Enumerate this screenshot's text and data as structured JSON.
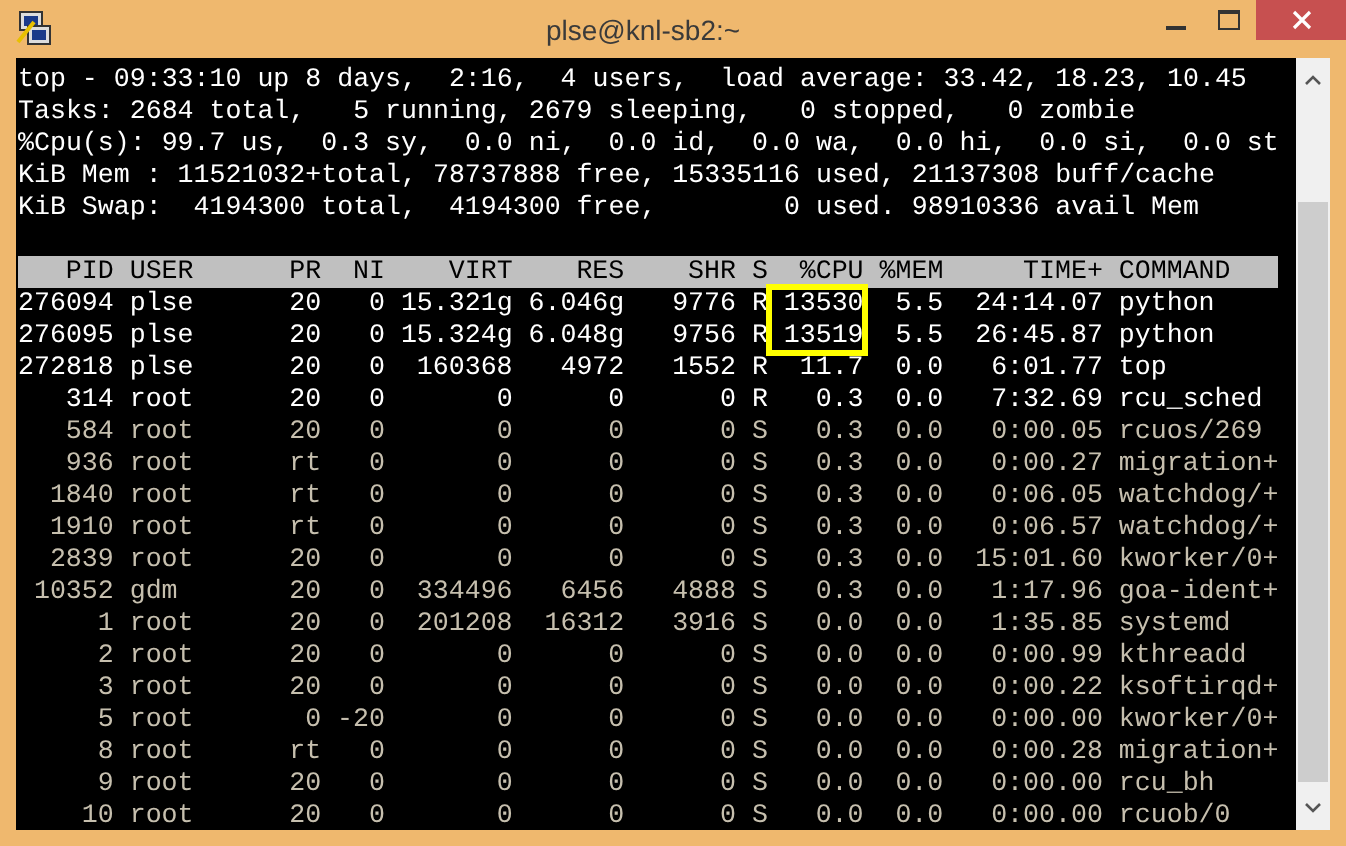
{
  "window": {
    "title": "plse@knl-sb2:~"
  },
  "summary": [
    "top - 09:33:10 up 8 days,  2:16,  4 users,  load average: 33.42, 18.23, 10.45",
    "Tasks: 2684 total,   5 running, 2679 sleeping,   0 stopped,   0 zombie",
    "%Cpu(s): 99.7 us,  0.3 sy,  0.0 ni,  0.0 id,  0.0 wa,  0.0 hi,  0.0 si,  0.0 st",
    "KiB Mem : 11521032+total, 78737888 free, 15335116 used, 21137308 buff/cache",
    "KiB Swap:  4194300 total,  4194300 free,        0 used. 98910336 avail Mem"
  ],
  "table": {
    "columns": [
      "PID",
      "USER",
      "PR",
      "NI",
      "VIRT",
      "RES",
      "SHR",
      "S",
      "%CPU",
      "%MEM",
      "TIME+",
      "COMMAND"
    ],
    "rows": [
      {
        "cells": [
          "276094",
          "plse",
          "20",
          "0",
          "15.321g",
          "6.046g",
          "9776",
          "R",
          "13530",
          "5.5",
          "24:14.07",
          "python"
        ],
        "bright": true,
        "boxed": true
      },
      {
        "cells": [
          "276095",
          "plse",
          "20",
          "0",
          "15.324g",
          "6.048g",
          "9756",
          "R",
          "13519",
          "5.5",
          "26:45.87",
          "python"
        ],
        "bright": true,
        "boxed": true
      },
      {
        "cells": [
          "272818",
          "plse",
          "20",
          "0",
          "160368",
          "4972",
          "1552",
          "R",
          "11.7",
          "0.0",
          "6:01.77",
          "top"
        ],
        "bright": true,
        "boxed": false
      },
      {
        "cells": [
          "314",
          "root",
          "20",
          "0",
          "0",
          "0",
          "0",
          "R",
          "0.3",
          "0.0",
          "7:32.69",
          "rcu_sched"
        ],
        "bright": true,
        "boxed": false
      },
      {
        "cells": [
          "584",
          "root",
          "20",
          "0",
          "0",
          "0",
          "0",
          "S",
          "0.3",
          "0.0",
          "0:00.05",
          "rcuos/269"
        ],
        "bright": false,
        "boxed": false
      },
      {
        "cells": [
          "936",
          "root",
          "rt",
          "0",
          "0",
          "0",
          "0",
          "S",
          "0.3",
          "0.0",
          "0:00.27",
          "migration+"
        ],
        "bright": false,
        "boxed": false
      },
      {
        "cells": [
          "1840",
          "root",
          "rt",
          "0",
          "0",
          "0",
          "0",
          "S",
          "0.3",
          "0.0",
          "0:06.05",
          "watchdog/+"
        ],
        "bright": false,
        "boxed": false
      },
      {
        "cells": [
          "1910",
          "root",
          "rt",
          "0",
          "0",
          "0",
          "0",
          "S",
          "0.3",
          "0.0",
          "0:06.57",
          "watchdog/+"
        ],
        "bright": false,
        "boxed": false
      },
      {
        "cells": [
          "2839",
          "root",
          "20",
          "0",
          "0",
          "0",
          "0",
          "S",
          "0.3",
          "0.0",
          "15:01.60",
          "kworker/0+"
        ],
        "bright": false,
        "boxed": false
      },
      {
        "cells": [
          "10352",
          "gdm",
          "20",
          "0",
          "334496",
          "6456",
          "4888",
          "S",
          "0.3",
          "0.0",
          "1:17.96",
          "goa-ident+"
        ],
        "bright": false,
        "boxed": false
      },
      {
        "cells": [
          "1",
          "root",
          "20",
          "0",
          "201208",
          "16312",
          "3916",
          "S",
          "0.0",
          "0.0",
          "1:35.85",
          "systemd"
        ],
        "bright": false,
        "boxed": false
      },
      {
        "cells": [
          "2",
          "root",
          "20",
          "0",
          "0",
          "0",
          "0",
          "S",
          "0.0",
          "0.0",
          "0:00.99",
          "kthreadd"
        ],
        "bright": false,
        "boxed": false
      },
      {
        "cells": [
          "3",
          "root",
          "20",
          "0",
          "0",
          "0",
          "0",
          "S",
          "0.0",
          "0.0",
          "0:00.22",
          "ksoftirqd+"
        ],
        "bright": false,
        "boxed": false
      },
      {
        "cells": [
          "5",
          "root",
          "0",
          "-20",
          "0",
          "0",
          "0",
          "S",
          "0.0",
          "0.0",
          "0:00.00",
          "kworker/0+"
        ],
        "bright": false,
        "boxed": false
      },
      {
        "cells": [
          "8",
          "root",
          "rt",
          "0",
          "0",
          "0",
          "0",
          "S",
          "0.0",
          "0.0",
          "0:00.28",
          "migration+"
        ],
        "bright": false,
        "boxed": false
      },
      {
        "cells": [
          "9",
          "root",
          "20",
          "0",
          "0",
          "0",
          "0",
          "S",
          "0.0",
          "0.0",
          "0:00.00",
          "rcu_bh"
        ],
        "bright": false,
        "boxed": false
      },
      {
        "cells": [
          "10",
          "root",
          "20",
          "0",
          "0",
          "0",
          "0",
          "S",
          "0.0",
          "0.0",
          "0:00.00",
          "rcuob/0"
        ],
        "bright": false,
        "boxed": false
      }
    ]
  }
}
